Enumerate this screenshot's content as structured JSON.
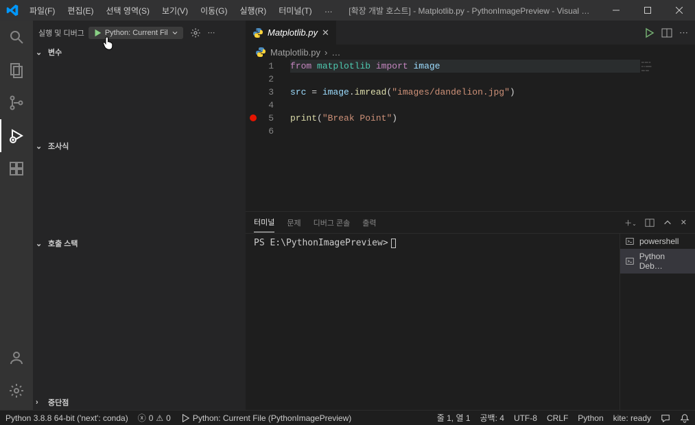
{
  "menu": {
    "file": "파일(F)",
    "edit": "편집(E)",
    "selection": "선택 영역(S)",
    "view": "보기(V)",
    "go": "이동(G)",
    "run": "실행(R)",
    "terminal": "터미널(T)",
    "more": "…"
  },
  "window_title": "[확장 개발 호스트] - Matplotlib.py - PythonImagePreview - Visual …",
  "sidebar": {
    "title": "실행 및 디버그",
    "config": "Python: Current Fil",
    "sections": {
      "variables": "변수",
      "watch": "조사식",
      "callstack": "호출 스택",
      "breakpoints": "중단점"
    }
  },
  "tab": {
    "filename": "Matplotlib.py"
  },
  "breadcrumb": {
    "file": "Matplotlib.py",
    "more": "…"
  },
  "code": {
    "l1_from": "from",
    "l1_matplotlib": "matplotlib",
    "l1_import": "import",
    "l1_image": "image",
    "l3_src": "src",
    "l3_eq": " = ",
    "l3_image": "image",
    "l3_dot": ".",
    "l3_imread": "imread",
    "l3_open": "(",
    "l3_str": "\"images/dandelion.jpg\"",
    "l3_close": ")",
    "l5_print": "print",
    "l5_open": "(",
    "l5_str": "\"Break Point\"",
    "l5_close": ")",
    "line_numbers": [
      "1",
      "2",
      "3",
      "4",
      "5",
      "6"
    ]
  },
  "panel": {
    "tabs": {
      "terminal": "터미널",
      "problems": "문제",
      "debug_console": "디버그 콘솔",
      "output": "출력"
    },
    "prompt": "PS E:\\PythonImagePreview>",
    "shells": {
      "powershell": "powershell",
      "python_debug": "Python Deb…"
    }
  },
  "status": {
    "python": "Python 3.8.8 64-bit ('next': conda)",
    "errors": "0",
    "warnings": "0",
    "debug_config": "Python: Current File (PythonImagePreview)",
    "ln_col": "줄 1, 열 1",
    "spaces": "공백: 4",
    "encoding": "UTF-8",
    "eol": "CRLF",
    "language": "Python",
    "kite": "kite: ready"
  }
}
